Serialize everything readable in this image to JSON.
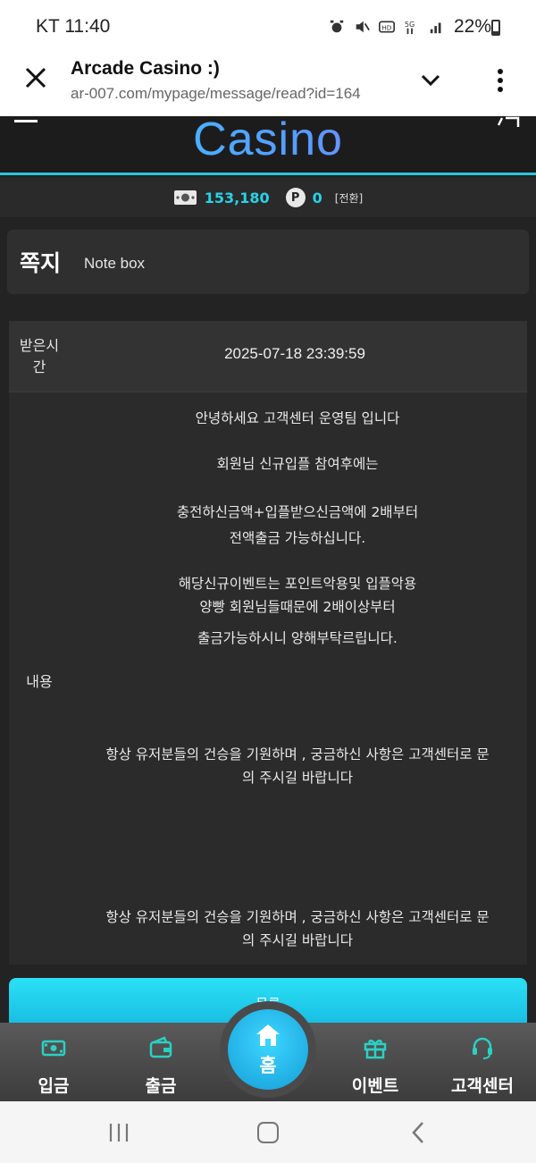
{
  "status_bar": {
    "carrier": "KT",
    "time": "11:40",
    "battery": "22%"
  },
  "browser": {
    "title": "Arcade Casino :)",
    "url": "ar-007.com/mypage/message/read?id=164"
  },
  "site": {
    "logo": "Casino",
    "money": "153,180",
    "points_icon": "P",
    "points": "0",
    "convert_label": "[전환]"
  },
  "note": {
    "title": "쪽지",
    "subtitle": "Note box"
  },
  "message": {
    "time_label": "받은시간",
    "time_label_line1": "받은시",
    "time_label_line2": "간",
    "time_value": "2025-07-18 23:39:59",
    "content_label": "내용",
    "lines": [
      "안녕하세요 고객센터 운영팀 입니다",
      "회원님 신규입플 참여후에는",
      "충전하신금액+입플받으신금액에 2배부터",
      "전액출금 가능하십니다.",
      "해당신규이벤트는 포인트악용및 입플악용",
      "양빵 회원님들때문에 2배이상부터",
      "출금가능하시니 양해부탁르립니다.",
      "항상 유저분들의 건승을 기원하며 , 궁금하신 사항은 고객센터로 문",
      "의 주시길 바랍니다",
      "항상 유저분들의 건승을 기원하며 , 궁금하신 사항은 고객센터로 문",
      "의 주시길 바랍니다"
    ]
  },
  "list_button": "목록",
  "bottom_nav": {
    "deposit": "입금",
    "withdraw": "출금",
    "home": "홈",
    "event": "이벤트",
    "support": "고객센터"
  },
  "colors": {
    "accent": "#27d3e6",
    "background": "#232323",
    "icon_teal": "#2ad1c3"
  }
}
